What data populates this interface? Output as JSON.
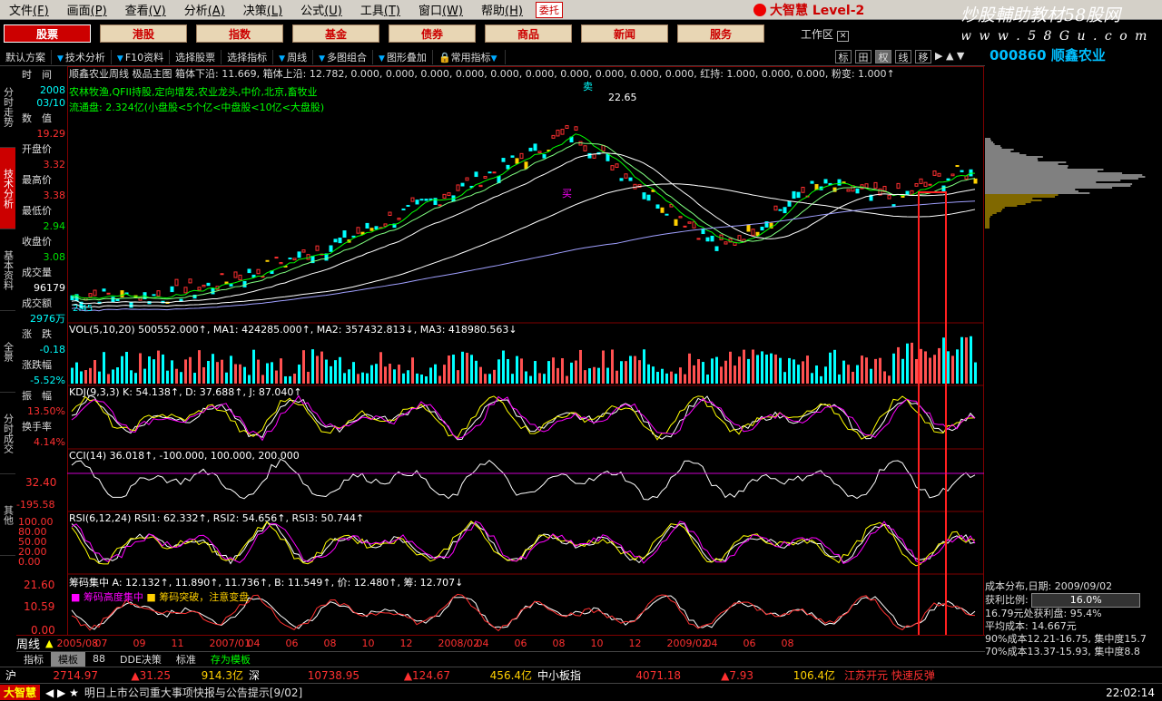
{
  "menu": {
    "items": [
      {
        "label": "文件",
        "key": "(F)"
      },
      {
        "label": "画面",
        "key": "(P)"
      },
      {
        "label": "查看",
        "key": "(V)"
      },
      {
        "label": "分析",
        "key": "(A)"
      },
      {
        "label": "决策",
        "key": "(L)"
      },
      {
        "label": "公式",
        "key": "(U)"
      },
      {
        "label": "工具",
        "key": "(T)"
      },
      {
        "label": "窗口",
        "key": "(W)"
      },
      {
        "label": "帮助",
        "key": "(H)"
      }
    ],
    "entrust": "委托",
    "brand": "大智慧 Level-2"
  },
  "watermark": {
    "line1": "炒股輔助教材58股网",
    "line2": "w w w . 5 8 G u . c o m"
  },
  "nav": {
    "buttons": [
      "股票",
      "港股",
      "指数",
      "基金",
      "债券",
      "商品",
      "新闻",
      "服务"
    ],
    "workarea": "工作区"
  },
  "toolbar": {
    "items": [
      "默认方案",
      "技术分析",
      "F10资料",
      "选择股票",
      "选择指标",
      "周线",
      "多图组合",
      "图形叠加",
      "常用指标"
    ],
    "toggles": [
      "标",
      "田",
      "权",
      "线",
      "移"
    ]
  },
  "stock": {
    "code": "000860",
    "name": "顺鑫农业"
  },
  "sidebar": {
    "tabs": [
      "分时走势",
      "技术分析",
      "基本资料",
      "全景",
      "分时成交",
      "其他"
    ]
  },
  "info": {
    "time_label": "时　间",
    "date_year": "2008",
    "date_md": "03/10",
    "value_label": "数　值",
    "value": "19.29",
    "open_label": "开盘价",
    "open": "3.32",
    "high_label": "最高价",
    "high": "3.38",
    "low_label": "最低价",
    "low": "2.94",
    "close_label": "收盘价",
    "close": "3.08",
    "vol_label": "成交量",
    "vol": "96179",
    "amt_label": "成交额",
    "amt": "2976万",
    "chg_label": "涨　跌",
    "chg": "-0.18",
    "pct_label": "涨跌幅",
    "pct": "-5.52%",
    "amp_label": "振　幅",
    "amp": "13.50%",
    "turn_label": "换手率",
    "turn": "4.14%"
  },
  "main_chart": {
    "header": "顺鑫农业周线 极品主图 箱体下沿: 11.669, 箱体上沿: 12.782, 0.000, 0.000, 0.000, 0.000, 0.000, 0.000, 0.000, 0.000, 0.000, 0.000, 红持: 1.000, 0.000, 0.000, 粉变: 1.000↑",
    "tags": "农林牧渔,QFII持股,定向增发,农业龙头,中价,北京,畜牧业",
    "float": "流通盘: 2.324亿(小盘股<5个亿<中盘股<10亿<大盘股)",
    "peak": "22.65",
    "low_mark": "2.45",
    "buy": "买",
    "sell": "卖",
    "hold": "仓"
  },
  "indicators": {
    "vol": "VOL(5,10,20) 500552.000↑, MA1: 424285.000↑, MA2: 357432.813↓, MA3: 418980.563↓",
    "kdj": "KDJ(9,3,3) K: 54.138↑, D: 37.688↑, J: 87.040↑",
    "cci": "CCI(14) 36.018↑, -100.000, 100.000, 200.000",
    "cci_hi": "32.40",
    "cci_lo": "-195.58",
    "rsi": "RSI(6,12,24) RSI1: 62.332↑, RSI2: 54.656↑, RSI3: 50.744↑",
    "rsi_ticks": [
      "100.00",
      "80.00",
      "50.00",
      "20.00",
      "0.00"
    ],
    "chip": "筹码集中 A: 12.132↑, 11.890↑, 11.736↑, B: 11.549↑, 价: 12.480↑, 筹: 12.707↓",
    "chip_legend1": "筹码高度集中",
    "chip_legend2": "筹码突破，注意变盘",
    "chip_ticks": [
      "21.60",
      "10.59",
      "0.00"
    ]
  },
  "xaxis": {
    "period": "周线",
    "labels": [
      "2005/08",
      "07",
      "09",
      "11",
      "2007/01",
      "04",
      "06",
      "08",
      "10",
      "12",
      "2008/02",
      "04",
      "06",
      "08",
      "10",
      "12",
      "2009/02",
      "04",
      "06",
      "08"
    ]
  },
  "right": {
    "dist_title": "成本分布,日期: 2009/09/02",
    "profit_label": "获利比例:",
    "profit": "16.0%",
    "lines": [
      "16.79元处获利盘: 95.4%",
      "平均成本: 14.667元",
      "90%成本12.21-16.75, 集中度15.7",
      "70%成本13.37-15.93, 集中度8.8"
    ]
  },
  "bottom_tabs": [
    "指标",
    "模板",
    "88",
    "DDE决策",
    "标准",
    "存为模板"
  ],
  "index_bar": {
    "sh": "沪",
    "sh_val": "2714.97",
    "sh_chg": "▲31.25",
    "sh_amt": "914.3亿",
    "sz": "深",
    "sz_val": "10738.95",
    "sz_chg": "▲124.67",
    "sz_amt": "456.4亿",
    "sme": "中小板指",
    "sme_val": "4071.18",
    "sme_chg": "▲7.93",
    "sme_amt": "106.4亿",
    "alert": "江苏开元 快速反弹"
  },
  "news": {
    "logo": "大智慧",
    "text": "明日上市公司重大事项快报与公告提示[9/02]",
    "time": "22:02:14"
  },
  "colors": {
    "up": "#ff3030",
    "down": "#00ffff",
    "accent": "#cc0000",
    "highlight_box": "#ff2020"
  }
}
